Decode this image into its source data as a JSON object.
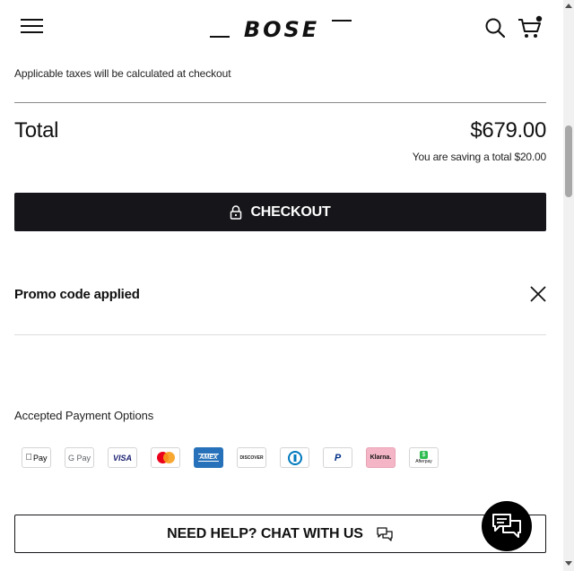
{
  "header": {
    "brand": "BOSE",
    "menu_icon": "hamburger-menu-icon",
    "search_icon": "search-icon",
    "cart_icon": "cart-icon",
    "cart_has_items": true
  },
  "summary": {
    "tax_note": "Applicable taxes will be calculated at checkout",
    "total_label": "Total",
    "total_value": "$679.00",
    "saving_note": "You are saving a total $20.00"
  },
  "checkout": {
    "label": "CHECKOUT",
    "icon": "lock-icon",
    "background": "#15151a"
  },
  "promo": {
    "label": "Promo code applied",
    "close_icon": "close-icon"
  },
  "payment": {
    "title": "Accepted Payment Options",
    "methods": [
      {
        "name": "Apple Pay",
        "label": "Pay"
      },
      {
        "name": "Google Pay",
        "label": "G Pay"
      },
      {
        "name": "Visa",
        "label": "VISA"
      },
      {
        "name": "Mastercard",
        "label": ""
      },
      {
        "name": "American Express",
        "label": "AMEX"
      },
      {
        "name": "Discover",
        "label": "DISCOVER"
      },
      {
        "name": "Diners Club",
        "label": ""
      },
      {
        "name": "PayPal",
        "label": "P"
      },
      {
        "name": "Klarna",
        "label": "Klarna."
      },
      {
        "name": "Afterpay",
        "label": "Afterpay"
      }
    ]
  },
  "help": {
    "label": "NEED HELP? CHAT WITH US",
    "icon": "chat-bubbles-icon"
  },
  "chat_fab": {
    "icon": "chat-bubbles-icon"
  }
}
